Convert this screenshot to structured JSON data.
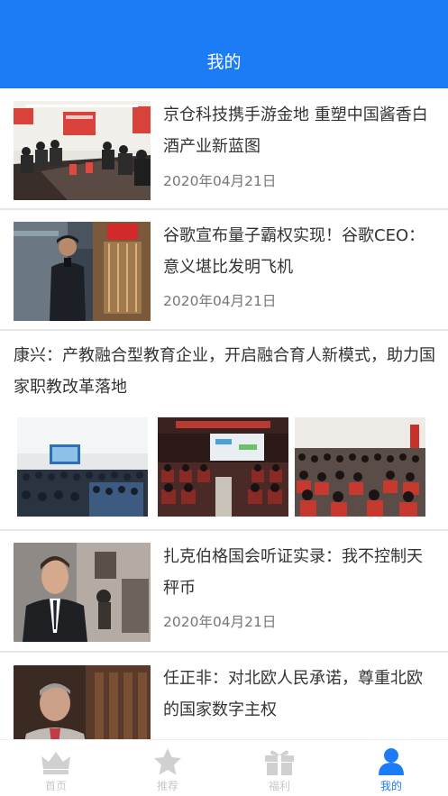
{
  "header": {
    "title": "我的"
  },
  "articles": [
    {
      "title": "京仓科技携手游金地 重塑中国酱香白酒产业新蓝图",
      "date": "2020年04月21日"
    },
    {
      "title": "谷歌宣布量子霸权实现！谷歌CEO：意义堪比发明飞机",
      "date": "2020年04月21日"
    },
    {
      "title": "康兴：产教融合型教育企业，开启融合育人新模式，助力国家职教改革落地"
    },
    {
      "title": "扎克伯格国会听证实录：我不控制天秤币",
      "date": "2020年04月21日"
    },
    {
      "title": "任正非：对北欧人民承诺，尊重北欧的国家数字主权"
    }
  ],
  "tabs": [
    {
      "label": "首页",
      "icon": "crown-icon"
    },
    {
      "label": "推荐",
      "icon": "star-icon"
    },
    {
      "label": "福利",
      "icon": "gift-icon"
    },
    {
      "label": "我的",
      "icon": "user-icon",
      "active": true
    }
  ],
  "colors": {
    "accent": "#1b7cf6",
    "inactive_tab": "#c8c8c8",
    "date_text": "#777777"
  }
}
